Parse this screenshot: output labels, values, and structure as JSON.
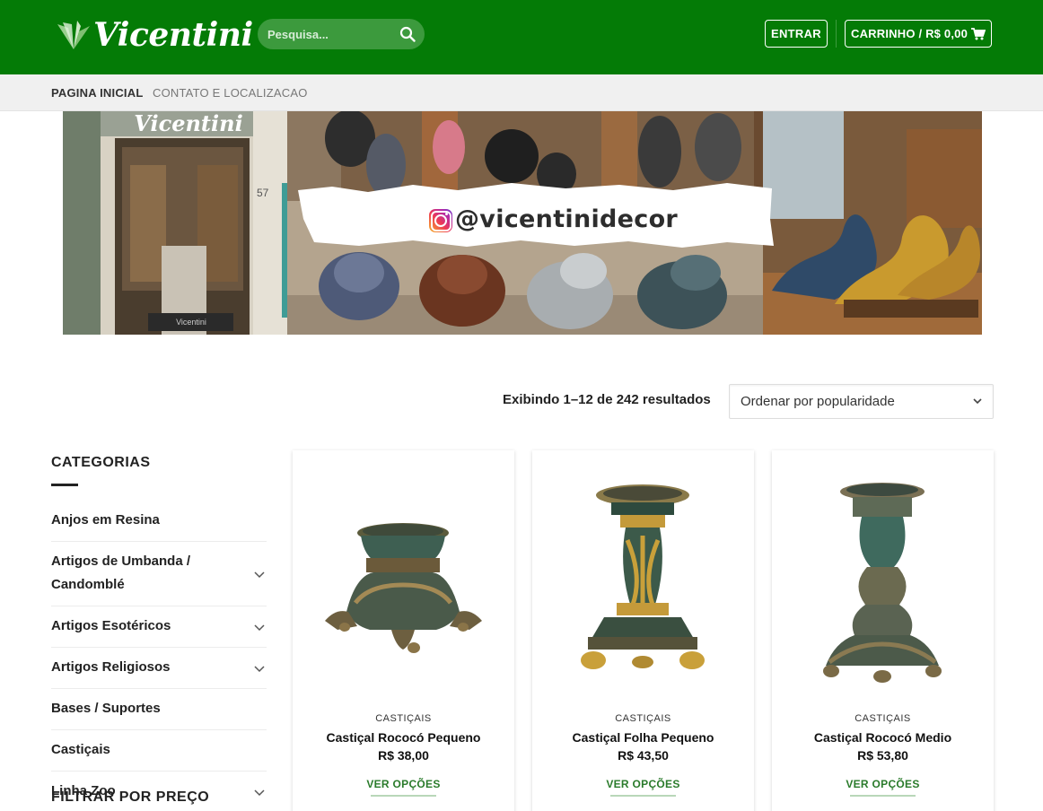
{
  "header": {
    "logo_text": "Vicentini",
    "search_placeholder": "Pesquisa...",
    "login_label": "ENTRAR",
    "cart_label": "CARRINHO / R$ 0,00",
    "colors": {
      "brand_green": "#047b06",
      "search_bg": "#3c9a3d"
    }
  },
  "nav": {
    "items": [
      {
        "label": "PAGINA INICIAL",
        "active": true
      },
      {
        "label": "CONTATO E LOCALIZACAO",
        "active": false
      }
    ]
  },
  "banner": {
    "store_sign": "Vicentini",
    "door_number": "57",
    "instagram_handle": "@vicentinidecor",
    "icon": "instagram-icon"
  },
  "catalog": {
    "results_text": "Exibindo 1–12 de 242 resultados",
    "sort_selected": "Ordenar por popularidade"
  },
  "sidebar": {
    "categories_title": "CATEGORIAS",
    "categories": [
      {
        "label": "Anjos em Resina",
        "expandable": false
      },
      {
        "label": "Artigos de Umbanda / Candomblé",
        "expandable": true
      },
      {
        "label": "Artigos Esotéricos",
        "expandable": true
      },
      {
        "label": "Artigos Religiosos",
        "expandable": true
      },
      {
        "label": "Bases / Suportes",
        "expandable": false
      },
      {
        "label": "Castiçais",
        "expandable": false
      },
      {
        "label": "Linha Zoo",
        "expandable": true
      }
    ],
    "filter_title": "FILTRAR POR PREÇO"
  },
  "products": [
    {
      "category": "CASTIÇAIS",
      "name": "Castiçal Rococó Pequeno",
      "price": "R$ 38,00",
      "button": "VER OPÇÕES"
    },
    {
      "category": "CASTIÇAIS",
      "name": "Castiçal Folha Pequeno",
      "price": "R$ 43,50",
      "button": "VER OPÇÕES"
    },
    {
      "category": "CASTIÇAIS",
      "name": "Castiçal Rococó Medio",
      "price": "R$ 53,80",
      "button": "VER OPÇÕES"
    }
  ]
}
